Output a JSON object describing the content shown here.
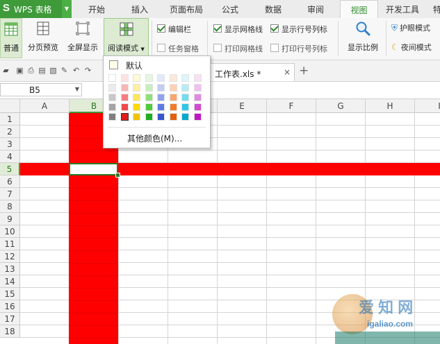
{
  "app": {
    "logo_letter": "S",
    "title": "WPS 表格"
  },
  "menu_tabs": [
    "开始",
    "插入",
    "页面布局",
    "公式",
    "数据",
    "审阅",
    "视图",
    "开发工具",
    "特"
  ],
  "active_tab": "视图",
  "ribbon": {
    "normal": "普通",
    "page_break": "分页预览",
    "fullscreen": "全屏显示",
    "reading_mode": "阅读模式",
    "edit_bar": "编辑栏",
    "task_pane": "任务窗格",
    "show_gridlines": "显示网格线",
    "print_gridlines": "打印网格线",
    "show_headers": "显示行号列标",
    "print_headers": "打印行号列标",
    "zoom": "显示比例",
    "eye_protect": "护眼模式",
    "night_mode": "夜间模式"
  },
  "checkboxes": {
    "edit_bar": true,
    "task_pane": false,
    "show_gridlines": true,
    "print_gridlines": false,
    "show_headers": true,
    "print_headers": false
  },
  "document_tab": {
    "name": "工作表.xls *",
    "close": "×",
    "new": "+"
  },
  "name_box": "B5",
  "columns": [
    "A",
    "B",
    "C",
    "D",
    "E",
    "F",
    "G",
    "H",
    "I"
  ],
  "rows": [
    "1",
    "2",
    "3",
    "4",
    "5",
    "6",
    "7",
    "8",
    "9",
    "10",
    "11",
    "12",
    "13",
    "14",
    "15",
    "16",
    "17",
    "18"
  ],
  "selected_cell": {
    "column": "B",
    "row": "5"
  },
  "highlight_color": "#ff0000",
  "dropdown": {
    "default_label": "默认",
    "more_colors": "其他颜色(M)...",
    "palette": [
      [
        "#ffffff",
        "#fde2e2",
        "#fff8d6",
        "#e6f7e1",
        "#e3e8fb",
        "#fde9d9",
        "#def6fb",
        "#f7e1f7"
      ],
      [
        "#ececec",
        "#f7b7b7",
        "#fff0a0",
        "#c7efba",
        "#c3ccf5",
        "#fbd1b3",
        "#b6ebf6",
        "#eec1ee"
      ],
      [
        "#c8c8c8",
        "#f47f7f",
        "#ffe65c",
        "#8fe07a",
        "#92a3ec",
        "#f7a66e",
        "#74dbef",
        "#e08ae0"
      ],
      [
        "#a4a4a4",
        "#ef4a4a",
        "#ffd800",
        "#4fcb3a",
        "#5f79e4",
        "#f27b2b",
        "#2ec7e6",
        "#d24ad2"
      ],
      [
        "#7f7f7f",
        "#e11e1e",
        "#f2c200",
        "#1fae1f",
        "#3a55cf",
        "#e35f0c",
        "#06a8cc",
        "#c018c0"
      ]
    ],
    "selected": "#e11e1e"
  },
  "watermark": {
    "text": "爱 知 网",
    "url": "igaliao.com"
  }
}
